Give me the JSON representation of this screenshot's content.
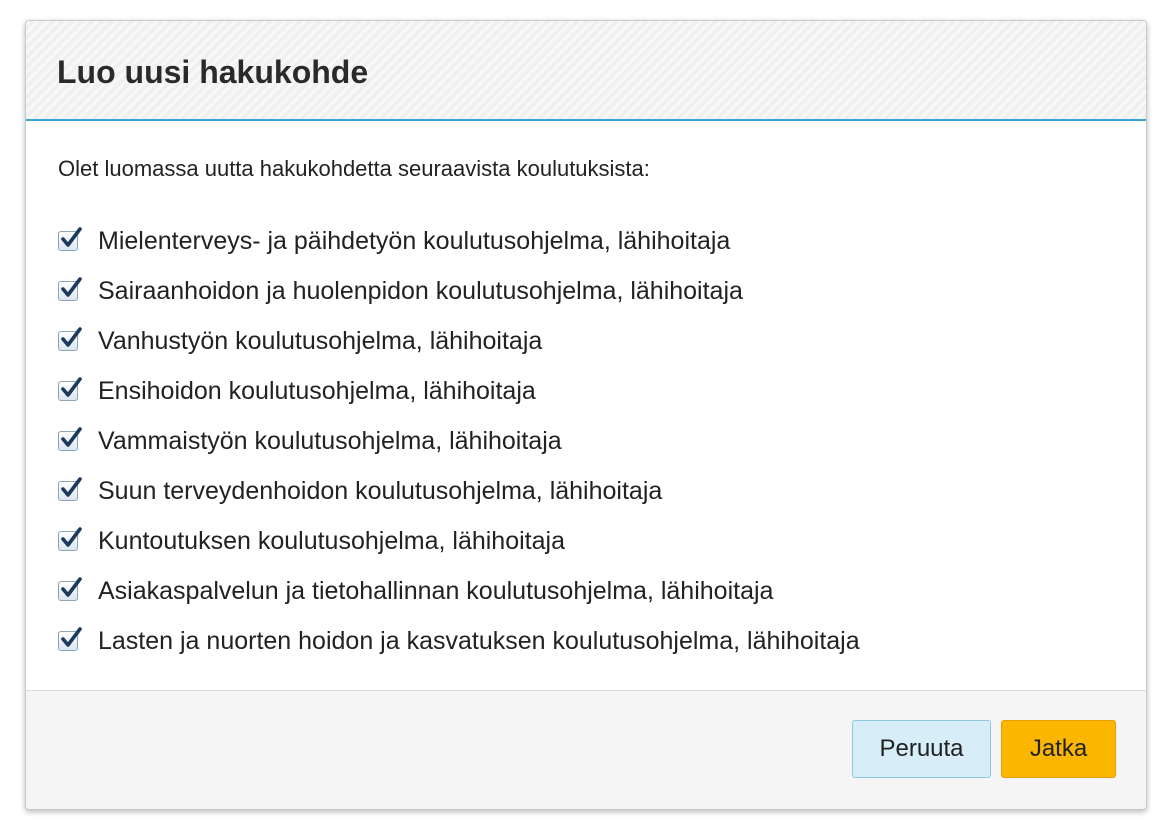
{
  "dialog": {
    "title": "Luo uusi hakukohde",
    "intro": "Olet luomassa uutta hakukohdetta seuraavista koulutuksista:",
    "courses": [
      {
        "label": "Mielenterveys- ja päihdetyön koulutusohjelma, lähihoitaja",
        "checked": true
      },
      {
        "label": "Sairaanhoidon ja huolenpidon koulutusohjelma, lähihoitaja",
        "checked": true
      },
      {
        "label": "Vanhustyön koulutusohjelma, lähihoitaja",
        "checked": true
      },
      {
        "label": "Ensihoidon koulutusohjelma, lähihoitaja",
        "checked": true
      },
      {
        "label": "Vammaistyön koulutusohjelma, lähihoitaja",
        "checked": true
      },
      {
        "label": "Suun terveydenhoidon koulutusohjelma, lähihoitaja",
        "checked": true
      },
      {
        "label": "Kuntoutuksen koulutusohjelma, lähihoitaja",
        "checked": true
      },
      {
        "label": "Asiakaspalvelun ja tietohallinnan koulutusohjelma, lähihoitaja",
        "checked": true
      },
      {
        "label": "Lasten ja nuorten hoidon ja kasvatuksen koulutusohjelma, lähihoitaja",
        "checked": true
      }
    ],
    "buttons": {
      "cancel": "Peruuta",
      "continue": "Jatka"
    }
  },
  "colors": {
    "header_accent": "#3ba3d3",
    "cancel_button": "#d7edf7",
    "continue_button": "#fbb600",
    "checkmark": "#1d3a5c"
  },
  "icons": {
    "checkbox": "checkmark-icon"
  }
}
